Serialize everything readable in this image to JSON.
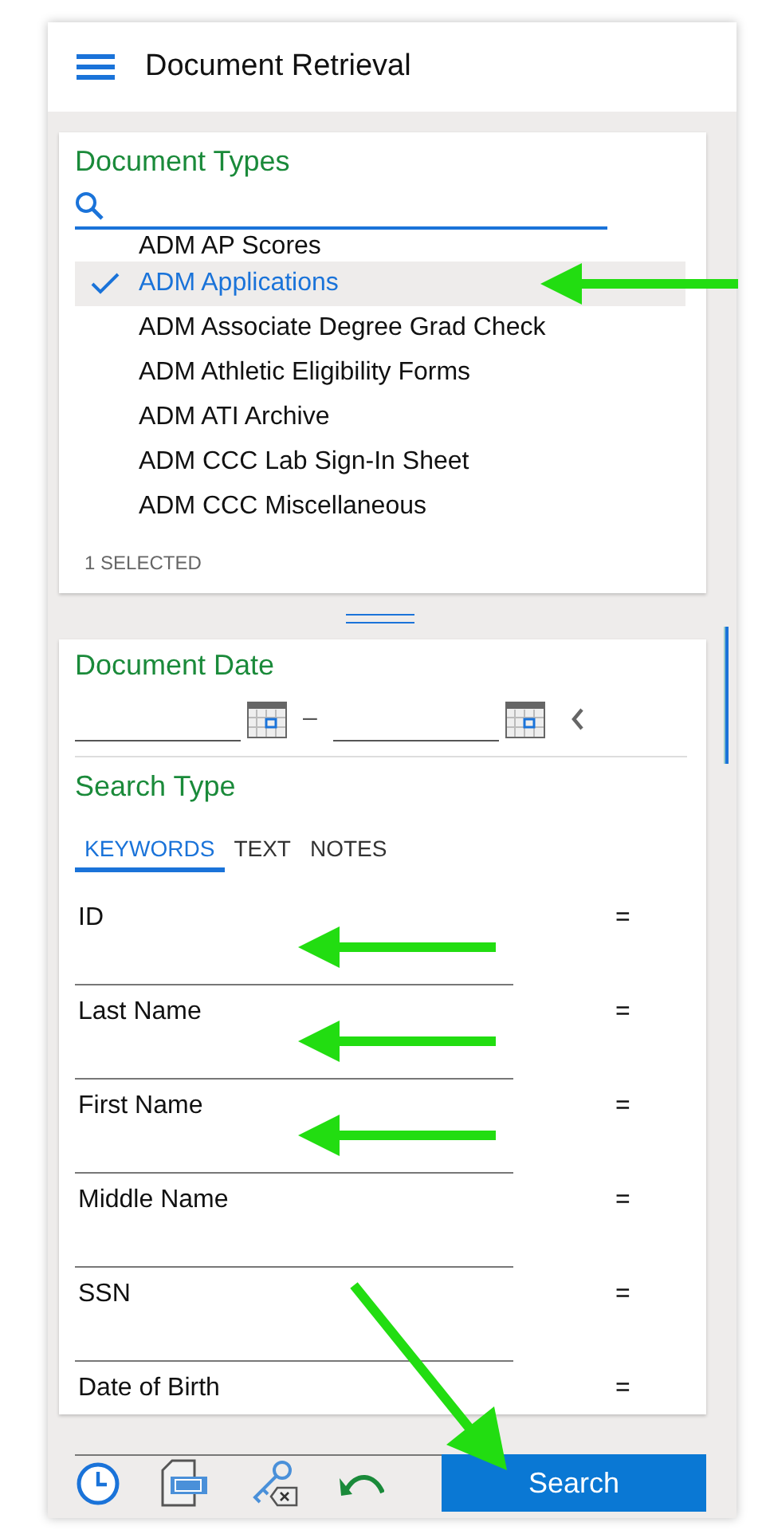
{
  "header": {
    "title": "Document Retrieval"
  },
  "document_types": {
    "title": "Document Types",
    "items": [
      {
        "label": "ADM AP Scores",
        "selected": false,
        "marked": false
      },
      {
        "label": "ADM Applications",
        "selected": true,
        "marked": true
      },
      {
        "label": "ADM Associate Degree Grad Check",
        "selected": false,
        "marked": false
      },
      {
        "label": "ADM Athletic Eligibility Forms",
        "selected": false,
        "marked": false
      },
      {
        "label": "ADM ATI Archive",
        "selected": false,
        "marked": false
      },
      {
        "label": "ADM CCC Lab Sign-In Sheet",
        "selected": false,
        "marked": false
      },
      {
        "label": "ADM CCC Miscellaneous",
        "selected": false,
        "marked": false
      }
    ],
    "selected_count": "1 SELECTED"
  },
  "document_date": {
    "title": "Document Date",
    "separator": "–"
  },
  "search_type": {
    "title": "Search Type",
    "tabs": [
      {
        "label": "KEYWORDS",
        "selected": true
      },
      {
        "label": "TEXT",
        "selected": false
      },
      {
        "label": "NOTES",
        "selected": false
      }
    ],
    "fields": [
      {
        "label": "ID",
        "operator": "=",
        "marked": true
      },
      {
        "label": "Last Name",
        "operator": "=",
        "marked": true
      },
      {
        "label": "First Name",
        "operator": "=",
        "marked": true
      },
      {
        "label": "Middle Name",
        "operator": "=",
        "marked": false
      },
      {
        "label": "SSN",
        "operator": "=",
        "marked": false
      },
      {
        "label": "Date of Birth",
        "operator": "=",
        "marked": false
      }
    ]
  },
  "toolbar": {
    "search_button": {
      "label": "Search",
      "marked": true
    }
  }
}
